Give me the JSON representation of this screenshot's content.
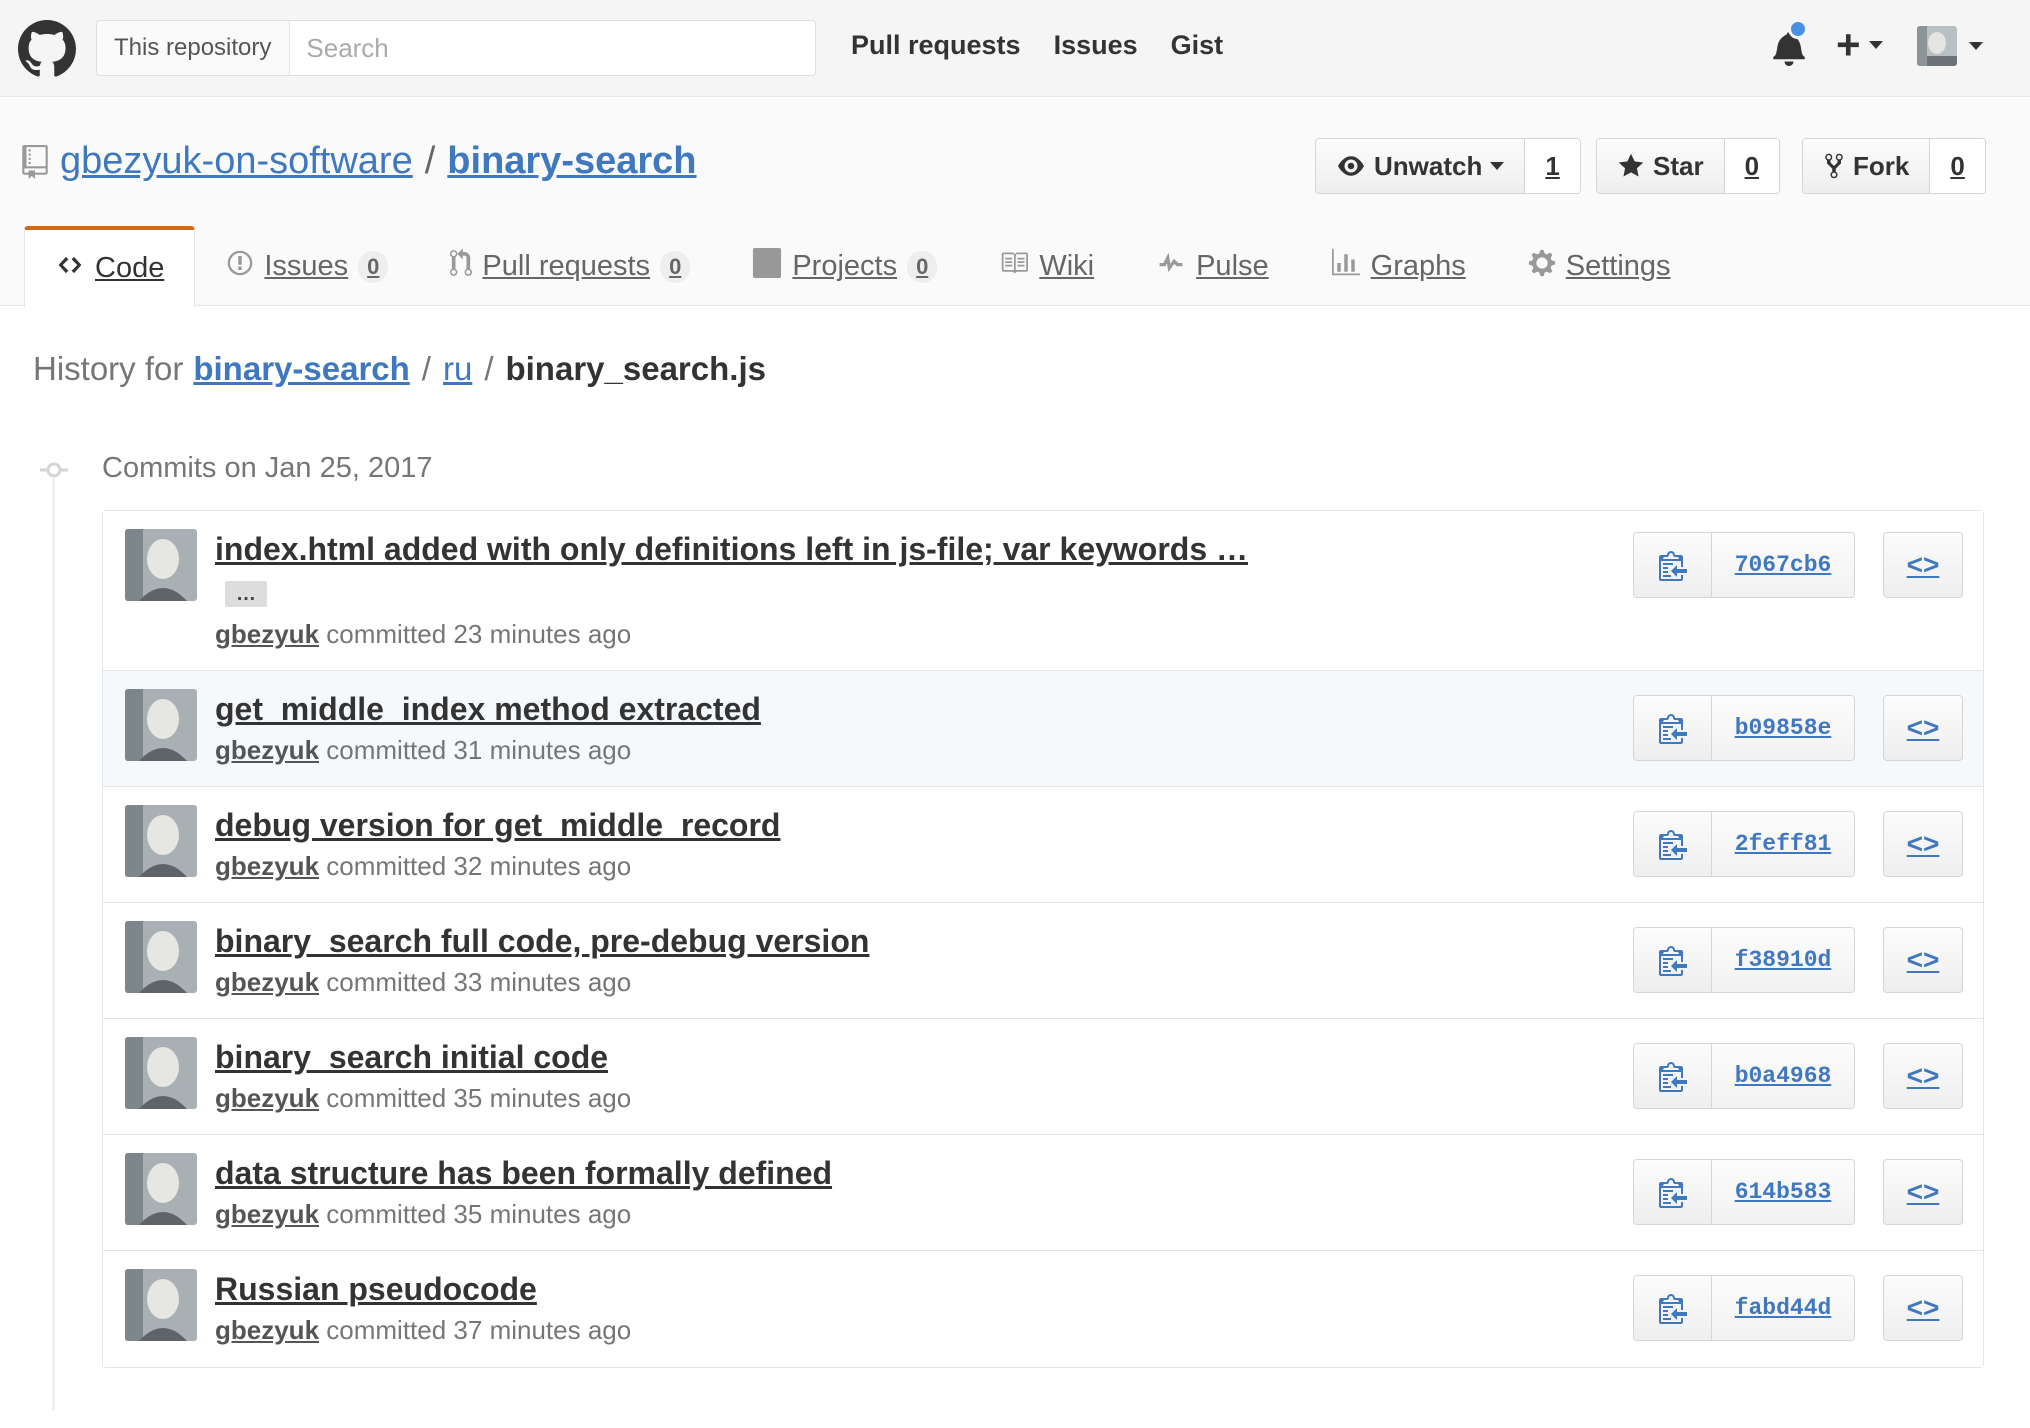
{
  "header": {
    "search_scope": "This repository",
    "search_placeholder": "Search",
    "nav": [
      "Pull requests",
      "Issues",
      "Gist"
    ],
    "plus_label": "+"
  },
  "repo": {
    "owner": "gbezyuk-on-software",
    "separator": "/",
    "name": "binary-search",
    "actions": {
      "unwatch_label": "Unwatch",
      "unwatch_count": "1",
      "star_label": "Star",
      "star_count": "0",
      "fork_label": "Fork",
      "fork_count": "0"
    }
  },
  "tabs": [
    {
      "label": "Code",
      "icon": "code-icon",
      "counter": null
    },
    {
      "label": "Issues",
      "icon": "issue-icon",
      "counter": "0"
    },
    {
      "label": "Pull requests",
      "icon": "pull-request-icon",
      "counter": "0"
    },
    {
      "label": "Projects",
      "icon": "project-icon",
      "counter": "0"
    },
    {
      "label": "Wiki",
      "icon": "book-icon",
      "counter": null
    },
    {
      "label": "Pulse",
      "icon": "pulse-icon",
      "counter": null
    },
    {
      "label": "Graphs",
      "icon": "graph-icon",
      "counter": null
    },
    {
      "label": "Settings",
      "icon": "gear-icon",
      "counter": null
    }
  ],
  "history": {
    "prefix": "History for",
    "root": "binary-search",
    "sep": "/",
    "dir": "ru",
    "file": "binary_search.js"
  },
  "commit_group": {
    "title": "Commits on Jan 25, 2017"
  },
  "commits": [
    {
      "title": "index.html added with only definitions left in js-file; var keywords …",
      "ellipsis": "…",
      "author": "gbezyuk",
      "verb": "committed",
      "when": "23 minutes ago",
      "sha": "7067cb6"
    },
    {
      "title": "get_middle_index method extracted",
      "author": "gbezyuk",
      "verb": "committed",
      "when": "31 minutes ago",
      "sha": "b09858e"
    },
    {
      "title": "debug version for get_middle_record",
      "author": "gbezyuk",
      "verb": "committed",
      "when": "32 minutes ago",
      "sha": "2feff81"
    },
    {
      "title": "binary_search full code, pre-debug version",
      "author": "gbezyuk",
      "verb": "committed",
      "when": "33 minutes ago",
      "sha": "f38910d"
    },
    {
      "title": "binary_search initial code",
      "author": "gbezyuk",
      "verb": "committed",
      "when": "35 minutes ago",
      "sha": "b0a4968"
    },
    {
      "title": "data structure has been formally defined",
      "author": "gbezyuk",
      "verb": "committed",
      "when": "35 minutes ago",
      "sha": "614b583"
    },
    {
      "title": "Russian pseudocode",
      "author": "gbezyuk",
      "verb": "committed",
      "when": "37 minutes ago",
      "sha": "fabd44d"
    }
  ],
  "browse_label": "<>",
  "colors": {
    "link": "#4078c0",
    "tab_accent": "#d26911",
    "notification": "#4a90e2"
  }
}
